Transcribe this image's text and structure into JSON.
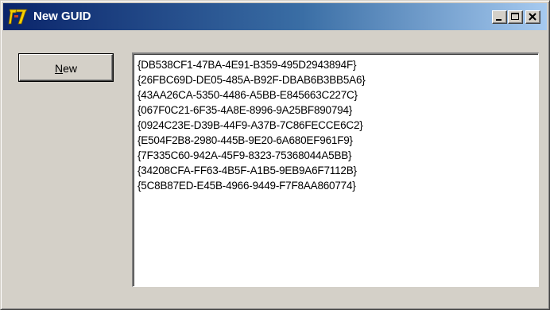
{
  "window": {
    "title": "New GUID",
    "icon": "app-icon"
  },
  "titlebar_buttons": {
    "minimize": "minimize-icon",
    "maximize": "maximize-icon",
    "close": "close-icon"
  },
  "toolbar": {
    "new_label_accel": "N",
    "new_label_rest": "ew"
  },
  "guids": [
    "{DB538CF1-47BA-4E91-B359-495D2943894F}",
    "{26FBC69D-DE05-485A-B92F-DBAB6B3BB5A6}",
    "{43AA26CA-5350-4486-A5BB-E845663C227C}",
    "{067F0C21-6F35-4A8E-8996-9A25BF890794}",
    "{0924C23E-D39B-44F9-A37B-7C86FECCE6C2}",
    "{E504F2B8-2980-445B-9E20-6A680EF961F9}",
    "{7F335C60-942A-45F9-8323-75368044A5BB}",
    "{34208CFA-FF63-4B5F-A1B5-9EB9A6F7112B}",
    "{5C8B87ED-E45B-4966-9449-F7F8AA860774}"
  ],
  "colors": {
    "title_start": "#0a246a",
    "title_end": "#a6caf0",
    "face": "#d4d0c8"
  }
}
